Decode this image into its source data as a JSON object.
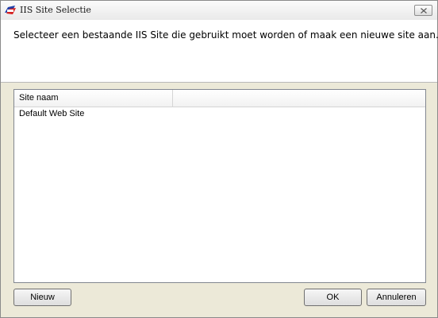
{
  "window": {
    "title": "IIS Site Selectie",
    "app_icon": "app-logo-icon",
    "close_icon": "close-icon"
  },
  "header": {
    "instruction": "Selecteer een bestaande IIS Site die gebruikt moet worden of maak een nieuwe site aan."
  },
  "list": {
    "columns": [
      "Site naam",
      ""
    ],
    "rows": [
      {
        "site_naam": "Default Web Site"
      }
    ]
  },
  "buttons": {
    "new_label": "Nieuw",
    "ok_label": "OK",
    "cancel_label": "Annuleren"
  }
}
